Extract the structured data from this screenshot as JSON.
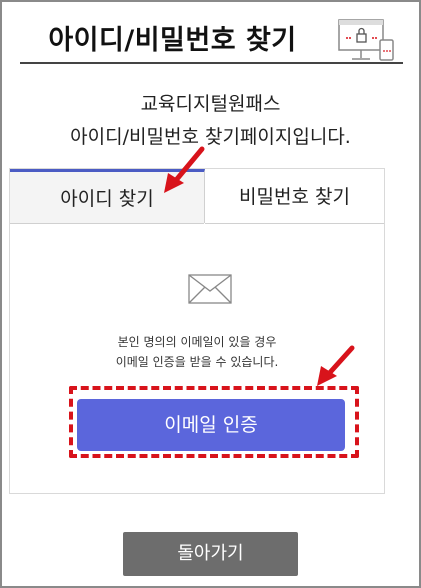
{
  "header": {
    "title": "아이디/비밀번호 찾기",
    "icon": "computer-lock-icon"
  },
  "intro": {
    "line1": "교육디지털원패스",
    "line2": "아이디/비밀번호 찾기페이지입니다."
  },
  "tabs": [
    {
      "label": "아이디 찾기",
      "active": true
    },
    {
      "label": "비밀번호 찾기",
      "active": false
    }
  ],
  "email_section": {
    "icon": "envelope-icon",
    "desc_line1": "본인 명의의 이메일이 있을 경우",
    "desc_line2": "이메일 인증을 받을 수 있습니다.",
    "button_label": "이메일 인증"
  },
  "footer": {
    "back_label": "돌아가기"
  },
  "colors": {
    "accent": "#5b66dc",
    "annotation_red": "#d8131b",
    "back_button": "#6d6d6d"
  }
}
